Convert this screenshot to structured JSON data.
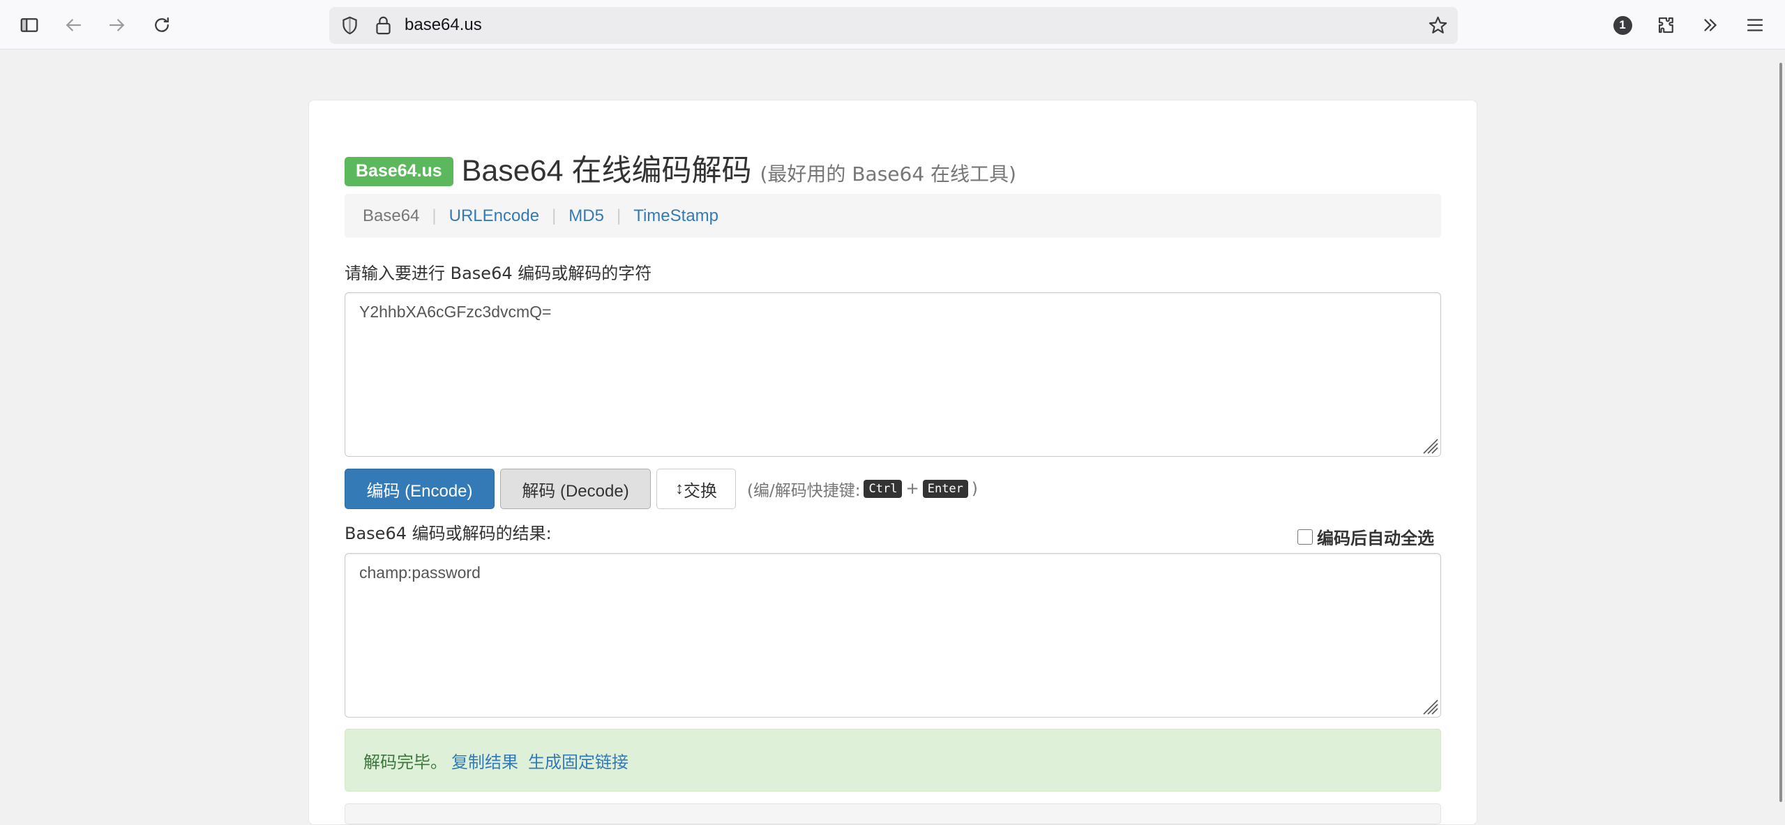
{
  "browser": {
    "url": "base64.us",
    "extension_badge": "1"
  },
  "page": {
    "brand_label": "Base64.us",
    "title": "Base64 在线编码解码",
    "subtitle": "(最好用的 Base64 在线工具)",
    "nav": {
      "active": "Base64",
      "links": [
        "URLEncode",
        "MD5",
        "TimeStamp"
      ],
      "separator": "|"
    },
    "input": {
      "label": "请输入要进行 Base64 编码或解码的字符",
      "value": "Y2hhbXA6cGFzc3dvcmQ="
    },
    "buttons": {
      "encode": "编码 (Encode)",
      "decode": "解码 (Decode)",
      "swap": "交换",
      "swap_icon_glyph": "↕"
    },
    "shortcut": {
      "prefix": "(编/解码快捷键:",
      "key1": "Ctrl",
      "plus": "+",
      "key2": "Enter",
      "suffix": ")"
    },
    "output": {
      "label": "Base64 编码或解码的结果:",
      "auto_select_label": "编码后自动全选",
      "value": "champ:password"
    },
    "alert": {
      "message": "解码完毕。",
      "copy_link": "复制结果",
      "permalink": "生成固定链接"
    }
  },
  "colors": {
    "brand_green": "#5cb85c",
    "primary_blue": "#337ab7",
    "success_bg": "#dff0d8",
    "success_text": "#3c763d"
  }
}
